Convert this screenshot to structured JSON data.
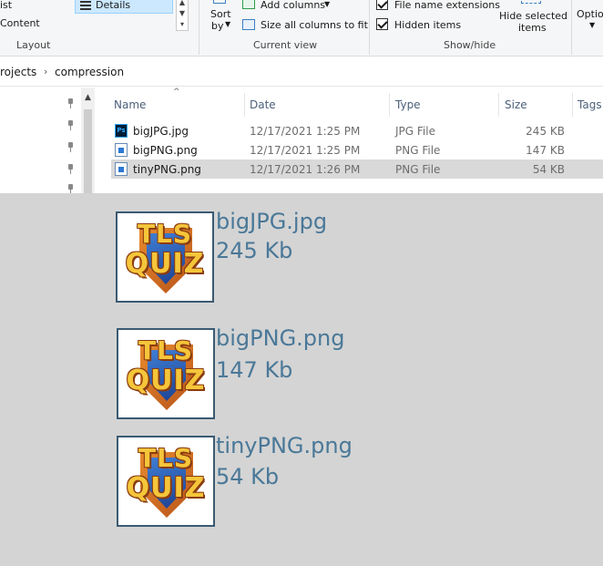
{
  "ribbon": {
    "layout_items": {
      "list": "ist",
      "content": "Content",
      "details": "Details"
    },
    "sort_label": "Sort",
    "sort_by": "by",
    "add_columns": "Add columns",
    "size_all_columns": "Size all columns to fit",
    "file_name_extensions": "File name extensions",
    "hidden_items": "Hidden items",
    "hide_selected_line1": "Hide selected",
    "hide_selected_line2": "items",
    "options": "Optio",
    "groups": {
      "layout": "Layout",
      "current_view": "Current view",
      "show_hide": "Show/hide"
    }
  },
  "address": {
    "parent": "rojects",
    "current": "compression"
  },
  "columns": {
    "name": "Name",
    "date": "Date",
    "type": "Type",
    "size": "Size",
    "tags": "Tags"
  },
  "files": [
    {
      "name": "bigJPG.jpg",
      "date": "12/17/2021 1:25 PM",
      "type": "JPG File",
      "size": "245 KB",
      "icon": "photoshop-icon",
      "selected": false
    },
    {
      "name": "bigPNG.png",
      "date": "12/17/2021 1:25 PM",
      "type": "PNG File",
      "size": "147 KB",
      "icon": "png-file-icon",
      "selected": false
    },
    {
      "name": "tinyPNG.png",
      "date": "12/17/2021 1:26 PM",
      "type": "PNG File",
      "size": "54 KB",
      "icon": "png-file-icon",
      "selected": true
    }
  ],
  "logo": {
    "line1": "TLS",
    "line2": "QUIZ"
  },
  "previews": [
    {
      "filename": "bigJPG.jpg",
      "size": "245 Kb"
    },
    {
      "filename": "bigPNG.png",
      "size": "147 Kb"
    },
    {
      "filename": "tinyPNG.png",
      "size": "54 Kb"
    }
  ],
  "colors": {
    "selection": "#d9d9d9",
    "details_highlight": "#cce8ff",
    "caption": "#4a7898",
    "preview_bg": "#d4d4d4"
  }
}
